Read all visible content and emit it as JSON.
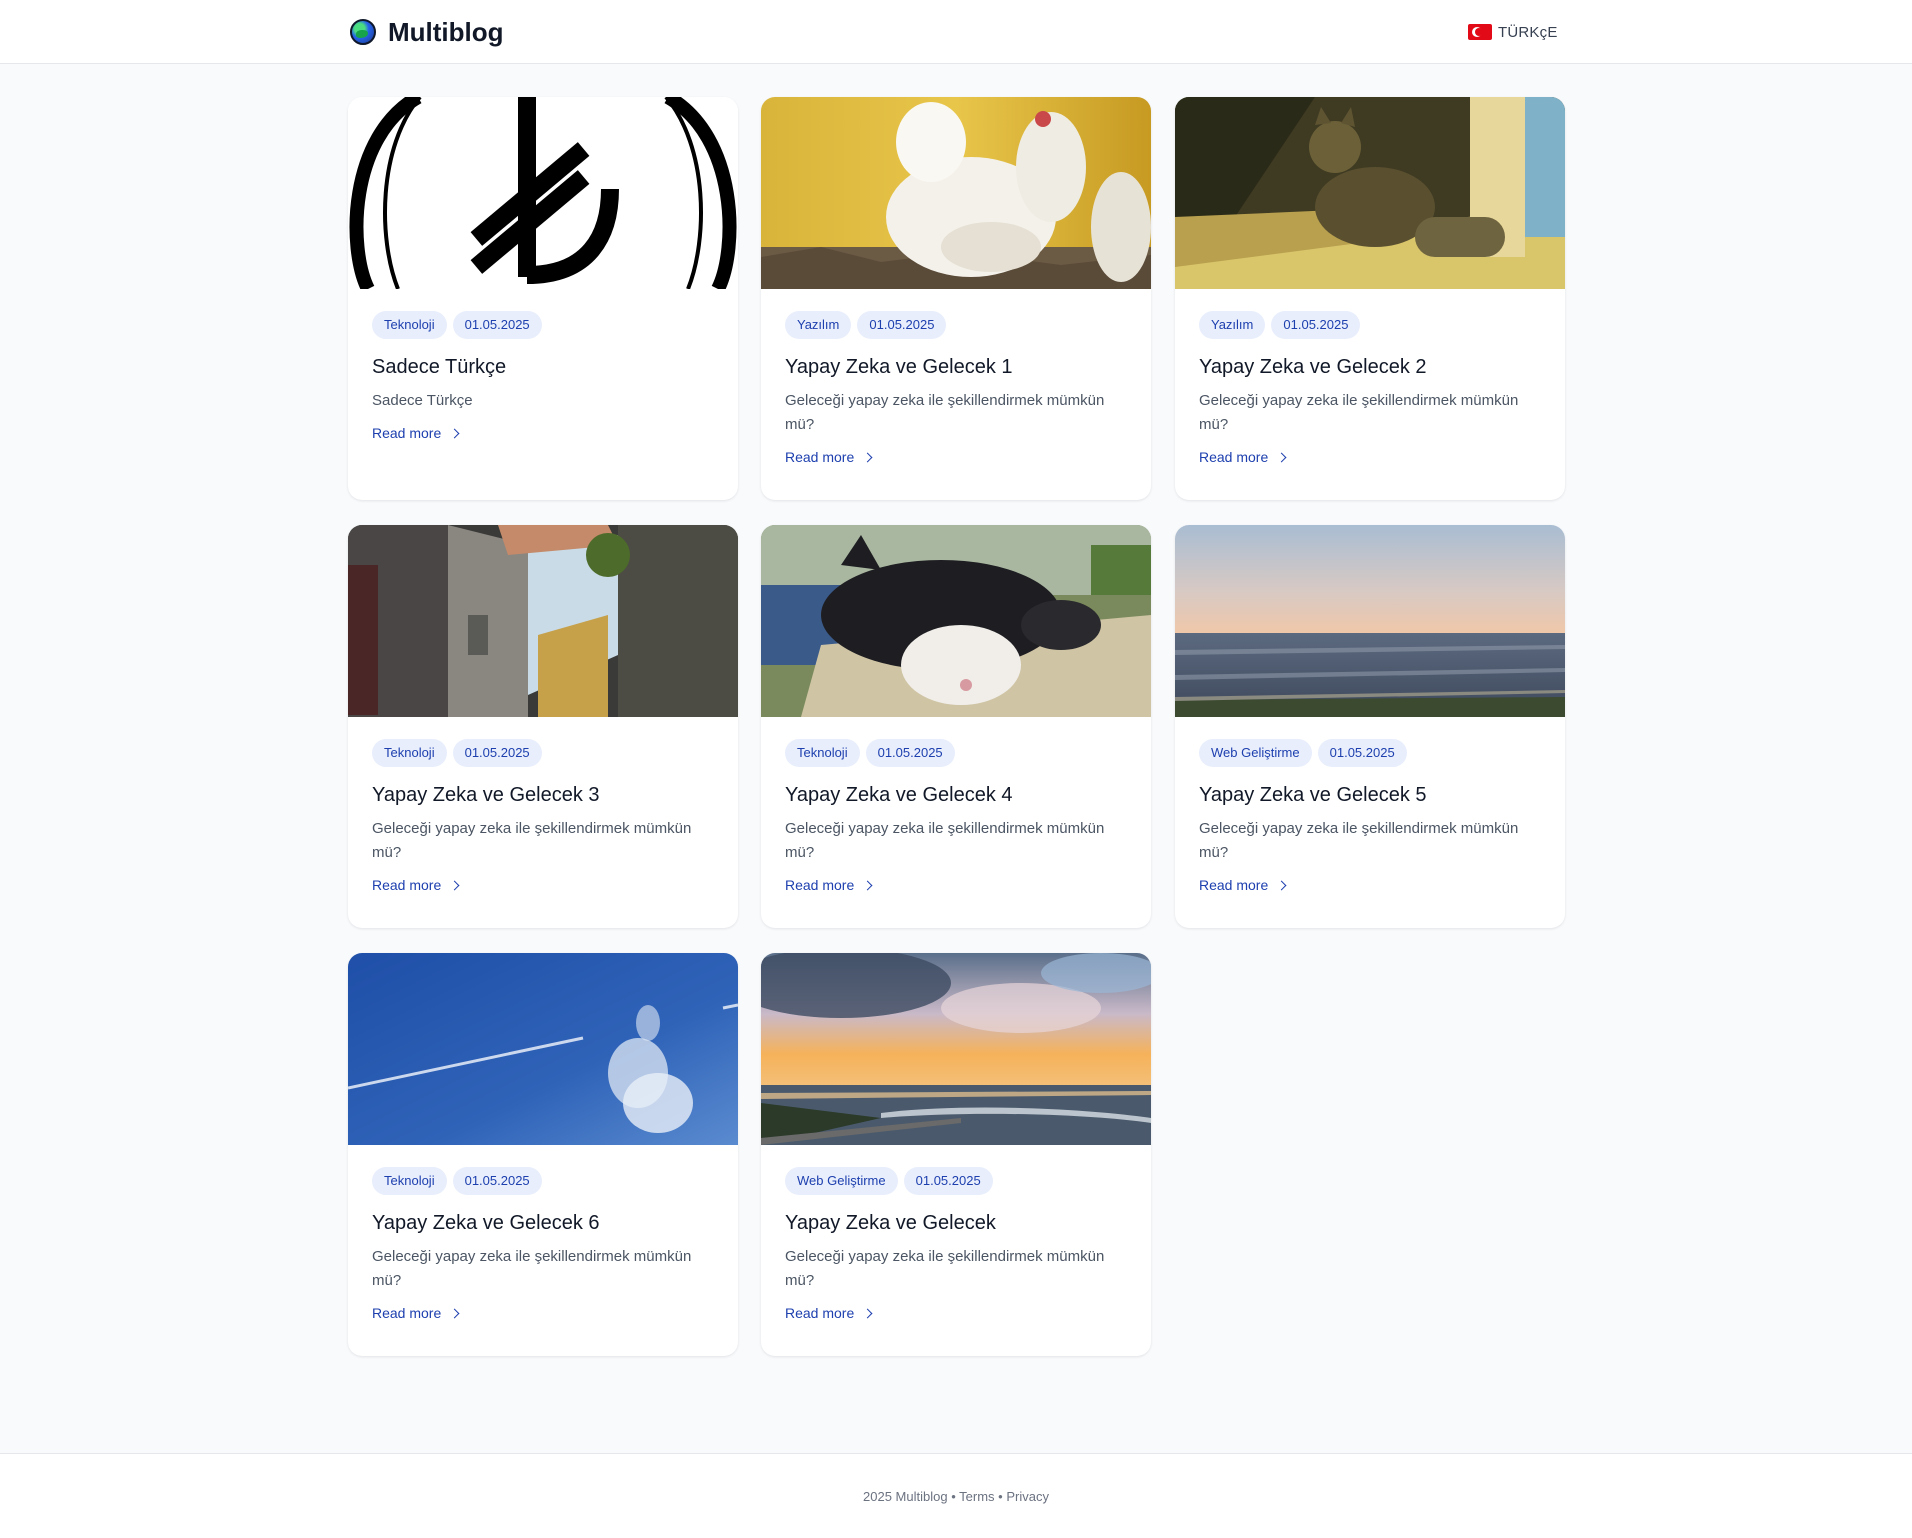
{
  "header": {
    "brand": "Multiblog",
    "language": "TÜRKçE"
  },
  "read_more_label": "Read more",
  "posts": [
    {
      "category": "Teknoloji",
      "date": "01.05.2025",
      "title": "Sadece Türkçe",
      "excerpt": "Sadece Türkçe"
    },
    {
      "category": "Yazılım",
      "date": "01.05.2025",
      "title": "Yapay Zeka ve Gelecek 1",
      "excerpt": "Geleceği yapay zeka ile şekillendirmek mümkün mü?"
    },
    {
      "category": "Yazılım",
      "date": "01.05.2025",
      "title": "Yapay Zeka ve Gelecek 2",
      "excerpt": "Geleceği yapay zeka ile şekillendirmek mümkün mü?"
    },
    {
      "category": "Teknoloji",
      "date": "01.05.2025",
      "title": "Yapay Zeka ve Gelecek 3",
      "excerpt": "Geleceği yapay zeka ile şekillendirmek mümkün mü?"
    },
    {
      "category": "Teknoloji",
      "date": "01.05.2025",
      "title": "Yapay Zeka ve Gelecek 4",
      "excerpt": "Geleceği yapay zeka ile şekillendirmek mümkün mü?"
    },
    {
      "category": "Web Geliştirme",
      "date": "01.05.2025",
      "title": "Yapay Zeka ve Gelecek 5",
      "excerpt": "Geleceği yapay zeka ile şekillendirmek mümkün mü?"
    },
    {
      "category": "Teknoloji",
      "date": "01.05.2025",
      "title": "Yapay Zeka ve Gelecek 6",
      "excerpt": "Geleceği yapay zeka ile şekillendirmek mümkün mü?"
    },
    {
      "category": "Web Geliştirme",
      "date": "01.05.2025",
      "title": "Yapay Zeka ve Gelecek",
      "excerpt": "Geleceği yapay zeka ile şekillendirmek mümkün mü?"
    }
  ],
  "footer": {
    "copyright": "2025 Multiblog",
    "sep": "•",
    "terms": "Terms",
    "privacy": "Privacy"
  },
  "colors": {
    "accent": "#1e40af",
    "tag_bg": "#e8eefc",
    "page_bg": "#f8fafc"
  }
}
